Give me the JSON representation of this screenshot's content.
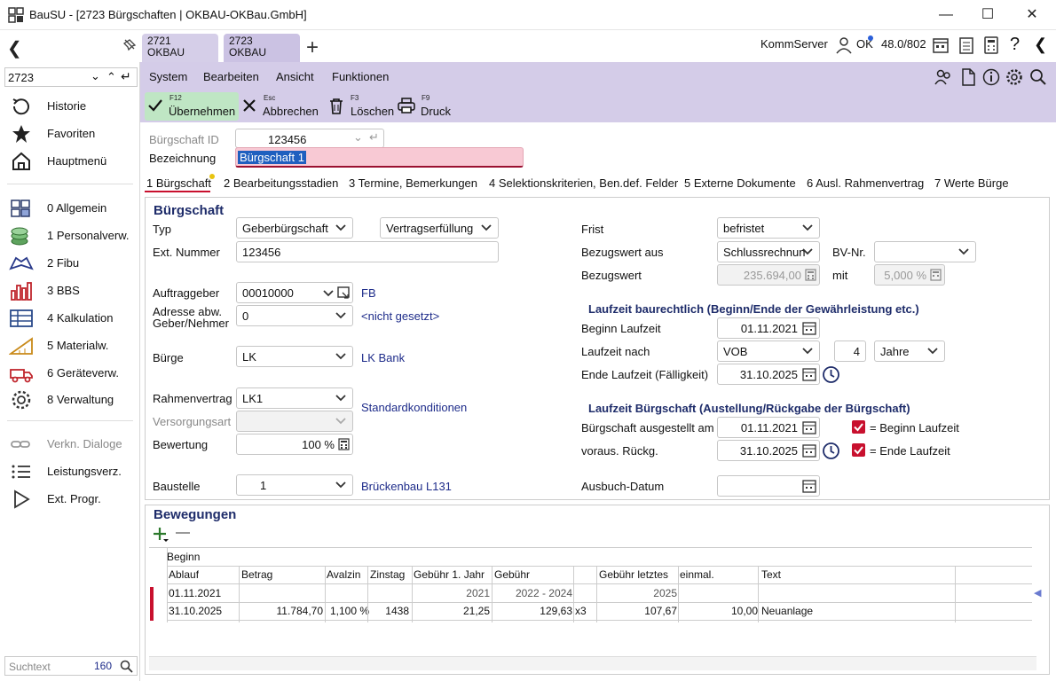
{
  "window": {
    "title": "BauSU - [2723 Bürgschaften | OKBAU-OKBau.GmbH]"
  },
  "tabs": [
    {
      "line1": "2721",
      "line2": "OKBAU"
    },
    {
      "line1": "2723",
      "line2": "OKBAU"
    }
  ],
  "topright": {
    "server": "KommServer",
    "user": "OK",
    "version": "48.0/802"
  },
  "sidebar": {
    "search_value": "2723",
    "items": [
      {
        "label": "Historie"
      },
      {
        "label": "Favoriten"
      },
      {
        "label": "Hauptmenü"
      },
      {
        "label": "0 Allgemein"
      },
      {
        "label": "1 Personalverw."
      },
      {
        "label": "2 Fibu"
      },
      {
        "label": "3 BBS"
      },
      {
        "label": "4 Kalkulation"
      },
      {
        "label": "5 Materialw."
      },
      {
        "label": "6 Geräteverw."
      },
      {
        "label": "8 Verwaltung"
      },
      {
        "label": "Verkn. Dialoge"
      },
      {
        "label": "Leistungsverz."
      },
      {
        "label": "Ext. Progr."
      }
    ],
    "bottom_placeholder": "Suchtext",
    "bottom_count": "160"
  },
  "menu": {
    "system": "System",
    "bearbeiten": "Bearbeiten",
    "ansicht": "Ansicht",
    "funktionen": "Funktionen"
  },
  "toolbar": {
    "uebernehmen_key": "F12",
    "uebernehmen": "Übernehmen",
    "abbrechen_key": "Esc",
    "abbrechen": "Abbrechen",
    "loeschen_key": "F3",
    "loeschen": "Löschen",
    "druck_key": "F9",
    "druck": "Druck"
  },
  "header": {
    "id_label": "Bürgschaft ID",
    "id_value": "123456",
    "bez_label": "Bezeichnung",
    "bez_value": "Bürgschaft 1"
  },
  "subtabs": [
    "1 Bürgschaft",
    "2 Bearbeitungsstadien",
    "3 Termine, Bemerkungen",
    "4 Selektionskriterien, Ben.def. Felder",
    "5 Externe Dokumente",
    "6 Ausl. Rahmenvertrag",
    "7 Werte Bürge"
  ],
  "form": {
    "section": "Bürgschaft",
    "typ_label": "Typ",
    "typ_value": "Geberbürgschaft",
    "typ2_value": "Vertragserfüllung",
    "extnr_label": "Ext. Nummer",
    "extnr_value": "123456",
    "auftraggeber_label": "Auftraggeber",
    "auftraggeber_value": "00010000",
    "auftraggeber_link": "FB",
    "adresse_label1": "Adresse abw.",
    "adresse_label2": "Geber/Nehmer",
    "adresse_value": "0",
    "adresse_link": "<nicht gesetzt>",
    "buerge_label": "Bürge",
    "buerge_value": "LK",
    "buerge_link": "LK Bank",
    "rahmen_label": "Rahmenvertrag",
    "rahmen_value": "LK1",
    "rahmen_link": "Standardkonditionen",
    "versorgung_label": "Versorgungsart",
    "bewertung_label": "Bewertung",
    "bewertung_value": "100 %",
    "baustelle_label": "Baustelle",
    "baustelle_value": "1",
    "baustelle_link": "Brückenbau L131",
    "frist_label": "Frist",
    "frist_value": "befristet",
    "bezugaus_label": "Bezugswert aus",
    "bezugaus_value": "Schlussrechnun",
    "bvnr_label": "BV-Nr.",
    "bezug_label": "Bezugswert",
    "bezug_value": "235.694,00",
    "mit_label": "mit",
    "mit_value": "5,000 %",
    "lz_section": "Laufzeit baurechtlich (Beginn/Ende der Gewährleistung etc.)",
    "beginn_label": "Beginn Laufzeit",
    "beginn_value": "01.11.2021",
    "nach_label": "Laufzeit nach",
    "nach_value": "VOB",
    "nach_num": "4",
    "nach_unit": "Jahre",
    "ende_label": "Ende Laufzeit (Fälligkeit)",
    "ende_value": "31.10.2025",
    "lb_section": "Laufzeit Bürgschaft (Austellung/Rückgabe der Bürgschaft)",
    "ausgestellt_label": "Bürgschaft ausgestellt am",
    "ausgestellt_value": "01.11.2021",
    "cb1_label": "= Beginn Laufzeit",
    "rueckg_label": "voraus. Rückg.",
    "rueckg_value": "31.10.2025",
    "cb2_label": "= Ende Laufzeit",
    "ausbuch_label": "Ausbuch-Datum"
  },
  "bewegungen": {
    "section": "Bewegungen",
    "head1": "Beginn",
    "columns": [
      "Ablauf",
      "Betrag",
      "Avalzin",
      "Zinstag",
      "Gebühr 1. Jahr",
      "Gebühr",
      "",
      "Gebühr letztes",
      "einmal.",
      "Text"
    ],
    "row1": [
      "01.11.2021",
      "",
      "",
      "",
      "2021",
      "2022 - 2024",
      "",
      "2025",
      "",
      ""
    ],
    "row2": [
      "31.10.2025",
      "11.784,70",
      "1,100 %",
      "1438",
      "21,25",
      "129,63",
      "x3",
      "107,67",
      "10,00",
      "Neuanlage"
    ]
  }
}
